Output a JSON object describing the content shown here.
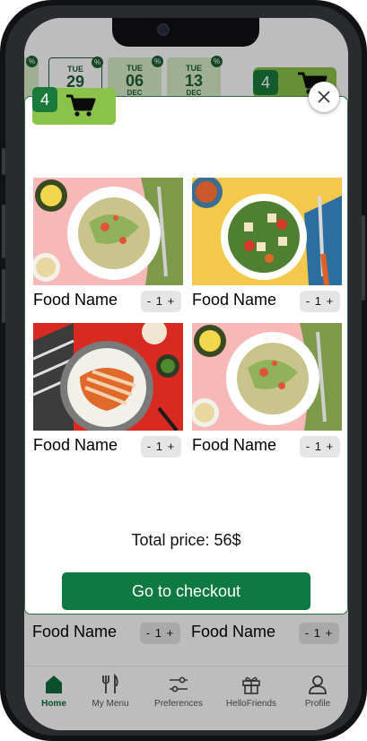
{
  "date_strip": [
    {
      "dow": "",
      "day": "",
      "mon": "",
      "discount": "%"
    },
    {
      "dow": "TUE",
      "day": "29",
      "mon": "",
      "discount": "%",
      "selected": true
    },
    {
      "dow": "TUE",
      "day": "06",
      "mon": "DEC",
      "discount": "%"
    },
    {
      "dow": "TUE",
      "day": "13",
      "mon": "DEC",
      "discount": "%"
    }
  ],
  "header_cart": {
    "count": "4"
  },
  "cart_modal": {
    "count": "4",
    "items": [
      {
        "name": "Food Name",
        "stepper": "- 1 +",
        "image": "pasta-zucchini-salad"
      },
      {
        "name": "Food Name",
        "stepper": "- 1 +",
        "image": "paneer-spinach-tomato-bowl"
      },
      {
        "name": "Food Name",
        "stepper": "- 1 +",
        "image": "rice-carrot-bowl"
      },
      {
        "name": "Food Name",
        "stepper": "- 1 +",
        "image": "pasta-zucchini-salad"
      }
    ],
    "total_label": "Total price: 56$",
    "checkout_label": "Go to checkout"
  },
  "background_row": [
    {
      "name": "Food Name",
      "stepper": "- 1 +"
    },
    {
      "name": "Food Name",
      "stepper": "- 1 +"
    }
  ],
  "tabbar": [
    {
      "label": "Home",
      "icon": "home-icon",
      "active": true
    },
    {
      "label": "My Menu",
      "icon": "fork-knife-icon"
    },
    {
      "label": "Preferences",
      "icon": "sliders-icon"
    },
    {
      "label": "HelloFriends",
      "icon": "gift-icon"
    },
    {
      "label": "Profile",
      "icon": "person-icon"
    }
  ],
  "colors": {
    "brand_green": "#0e7a42",
    "cart_lime": "#8bc34a",
    "date_card_bg": "#d7ecc6",
    "active_tab": "#0f6b3a"
  }
}
